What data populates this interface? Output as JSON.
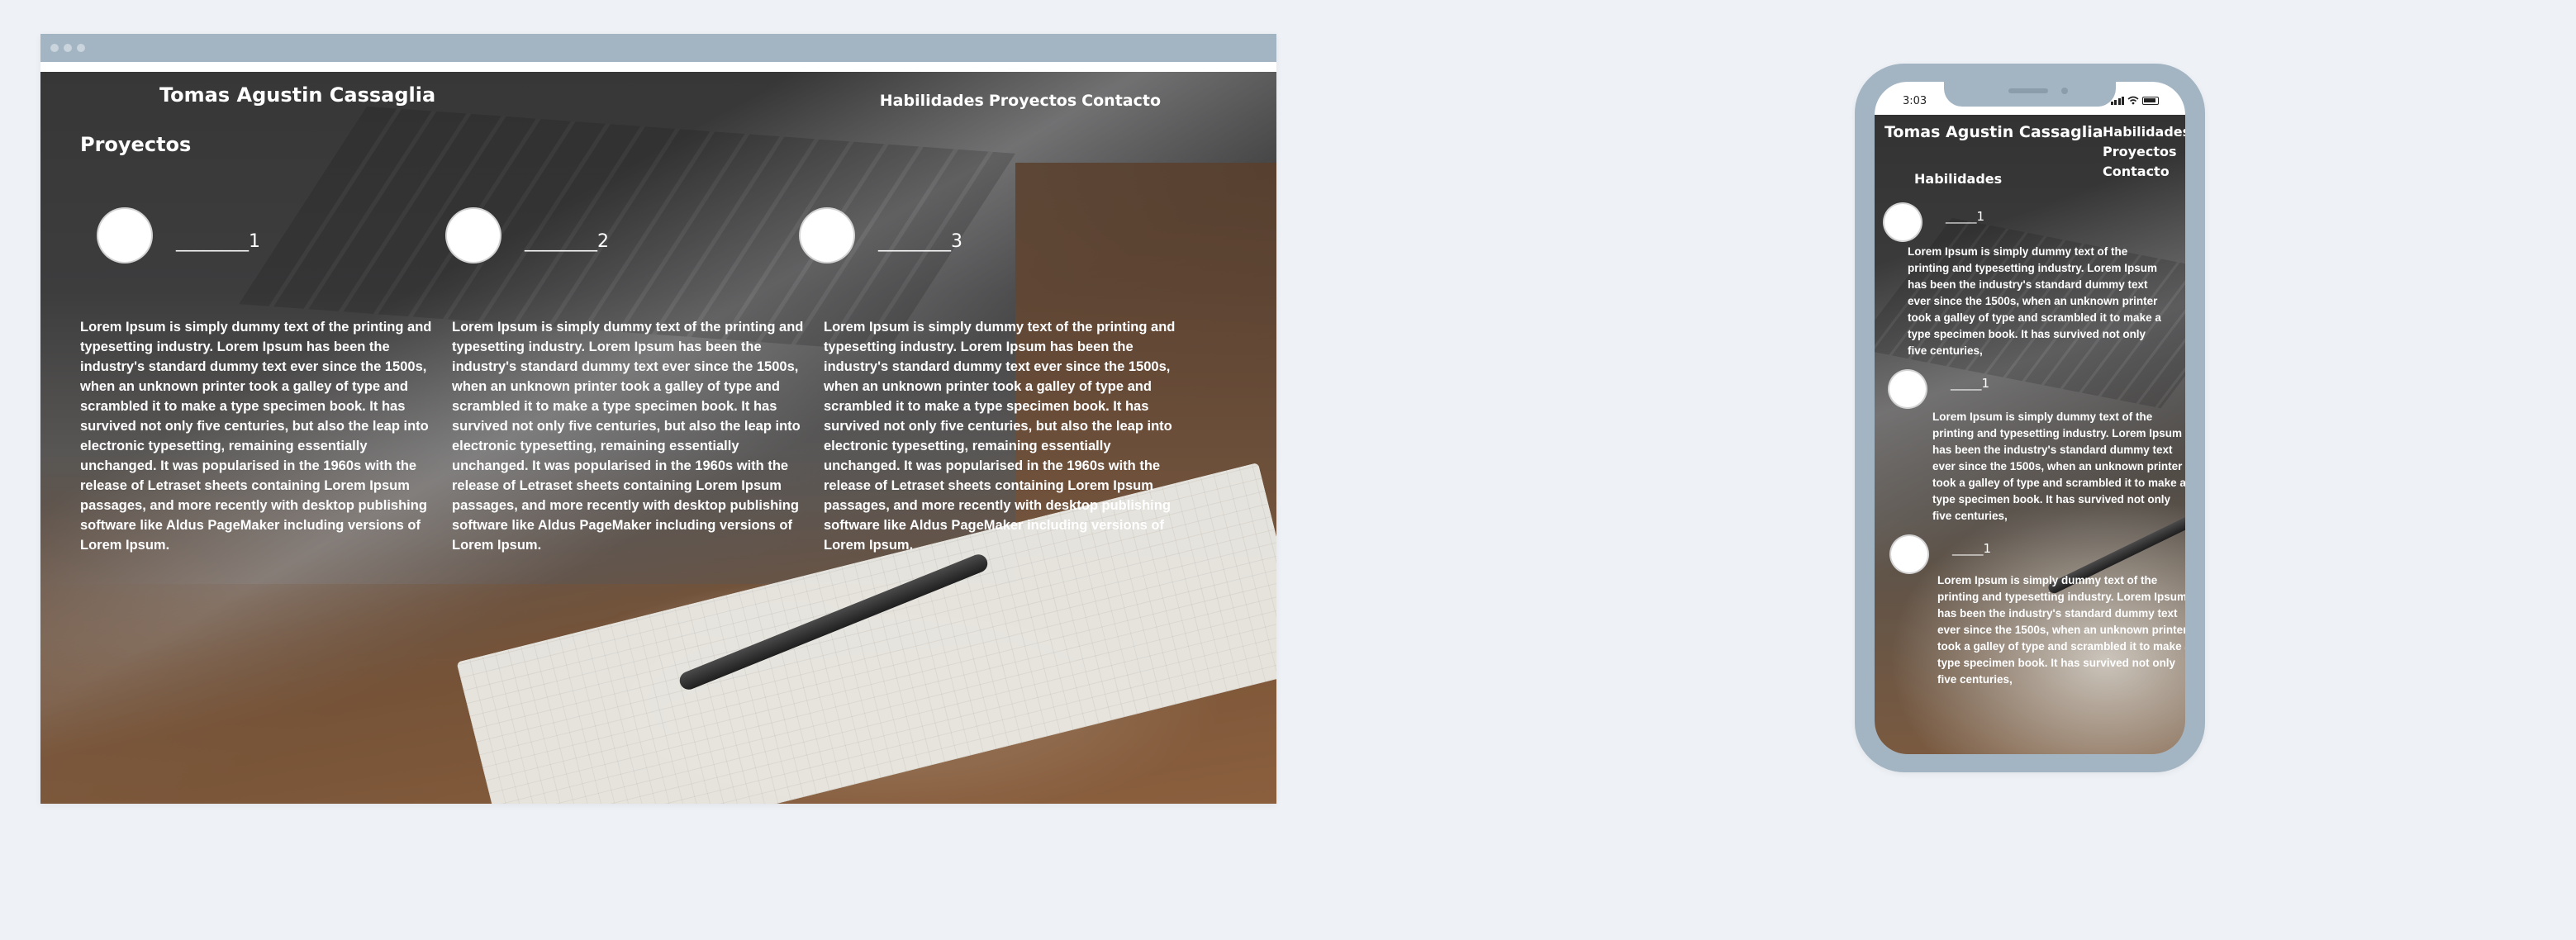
{
  "site": {
    "title": "Tomas Agustin Cassaglia",
    "nav": [
      "Habilidades",
      "Proyectos",
      "Contacto"
    ]
  },
  "desktop": {
    "section_title": "Proyectos",
    "projects": [
      {
        "name": "________1",
        "description": "Lorem Ipsum is simply dummy text of the printing and typesetting industry. Lorem Ipsum has been the industry's standard dummy text ever since the 1500s, when an unknown printer took a galley of type and scrambled it to make a type specimen book. It has survived not only five centuries, but also the leap into electronic typesetting, remaining essentially unchanged. It was popularised in the 1960s with the release of Letraset sheets containing Lorem Ipsum passages, and more recently with desktop publishing software like Aldus PageMaker including versions of Lorem Ipsum."
      },
      {
        "name": "________2",
        "description": "Lorem Ipsum is simply dummy text of the printing and typesetting industry. Lorem Ipsum has been the industry's standard dummy text ever since the 1500s, when an unknown printer took a galley of type and scrambled it to make a type specimen book. It has survived not only five centuries, but also the leap into electronic typesetting, remaining essentially unchanged. It was popularised in the 1960s with the release of Letraset sheets containing Lorem Ipsum passages, and more recently with desktop publishing software like Aldus PageMaker including versions of Lorem Ipsum."
      },
      {
        "name": "________3",
        "description": "Lorem Ipsum is simply dummy text of the printing and typesetting industry. Lorem Ipsum has been the industry's standard dummy text ever since the 1500s, when an unknown printer took a galley of type and scrambled it to make a type specimen book. It has survived not only five centuries, but also the leap into electronic typesetting, remaining essentially unchanged. It was popularised in the 1960s with the release of Letraset sheets containing Lorem Ipsum passages, and more recently with desktop publishing software like Aldus PageMaker including versions of Lorem Ipsum."
      }
    ]
  },
  "mobile": {
    "status_time": "3:03",
    "section_title": "Habilidades",
    "projects": [
      {
        "name": "_____1",
        "description": "Lorem Ipsum is simply dummy text of the printing and typesetting industry. Lorem Ipsum has been the industry's standard dummy text ever since the 1500s, when an unknown printer took a galley of type and scrambled it to make a type specimen book. It has survived not only five centuries,"
      },
      {
        "name": "_____1",
        "description": "Lorem Ipsum is simply dummy text of the printing and typesetting industry. Lorem Ipsum has been the industry's standard dummy text ever since the 1500s, when an unknown printer took a galley of type and scrambled it to make a type specimen book. It has survived not only five centuries,"
      },
      {
        "name": "_____1",
        "description": "Lorem Ipsum is simply dummy text of the printing and typesetting industry. Lorem Ipsum has been the industry's standard dummy text ever since the 1500s, when an unknown printer took a galley of type and scrambled it to make a type specimen book. It has survived not only five centuries,"
      }
    ]
  },
  "colors": {
    "background": "#eef2f6",
    "mockup_frame": "#a3b4c3",
    "text": "#ffffff"
  }
}
